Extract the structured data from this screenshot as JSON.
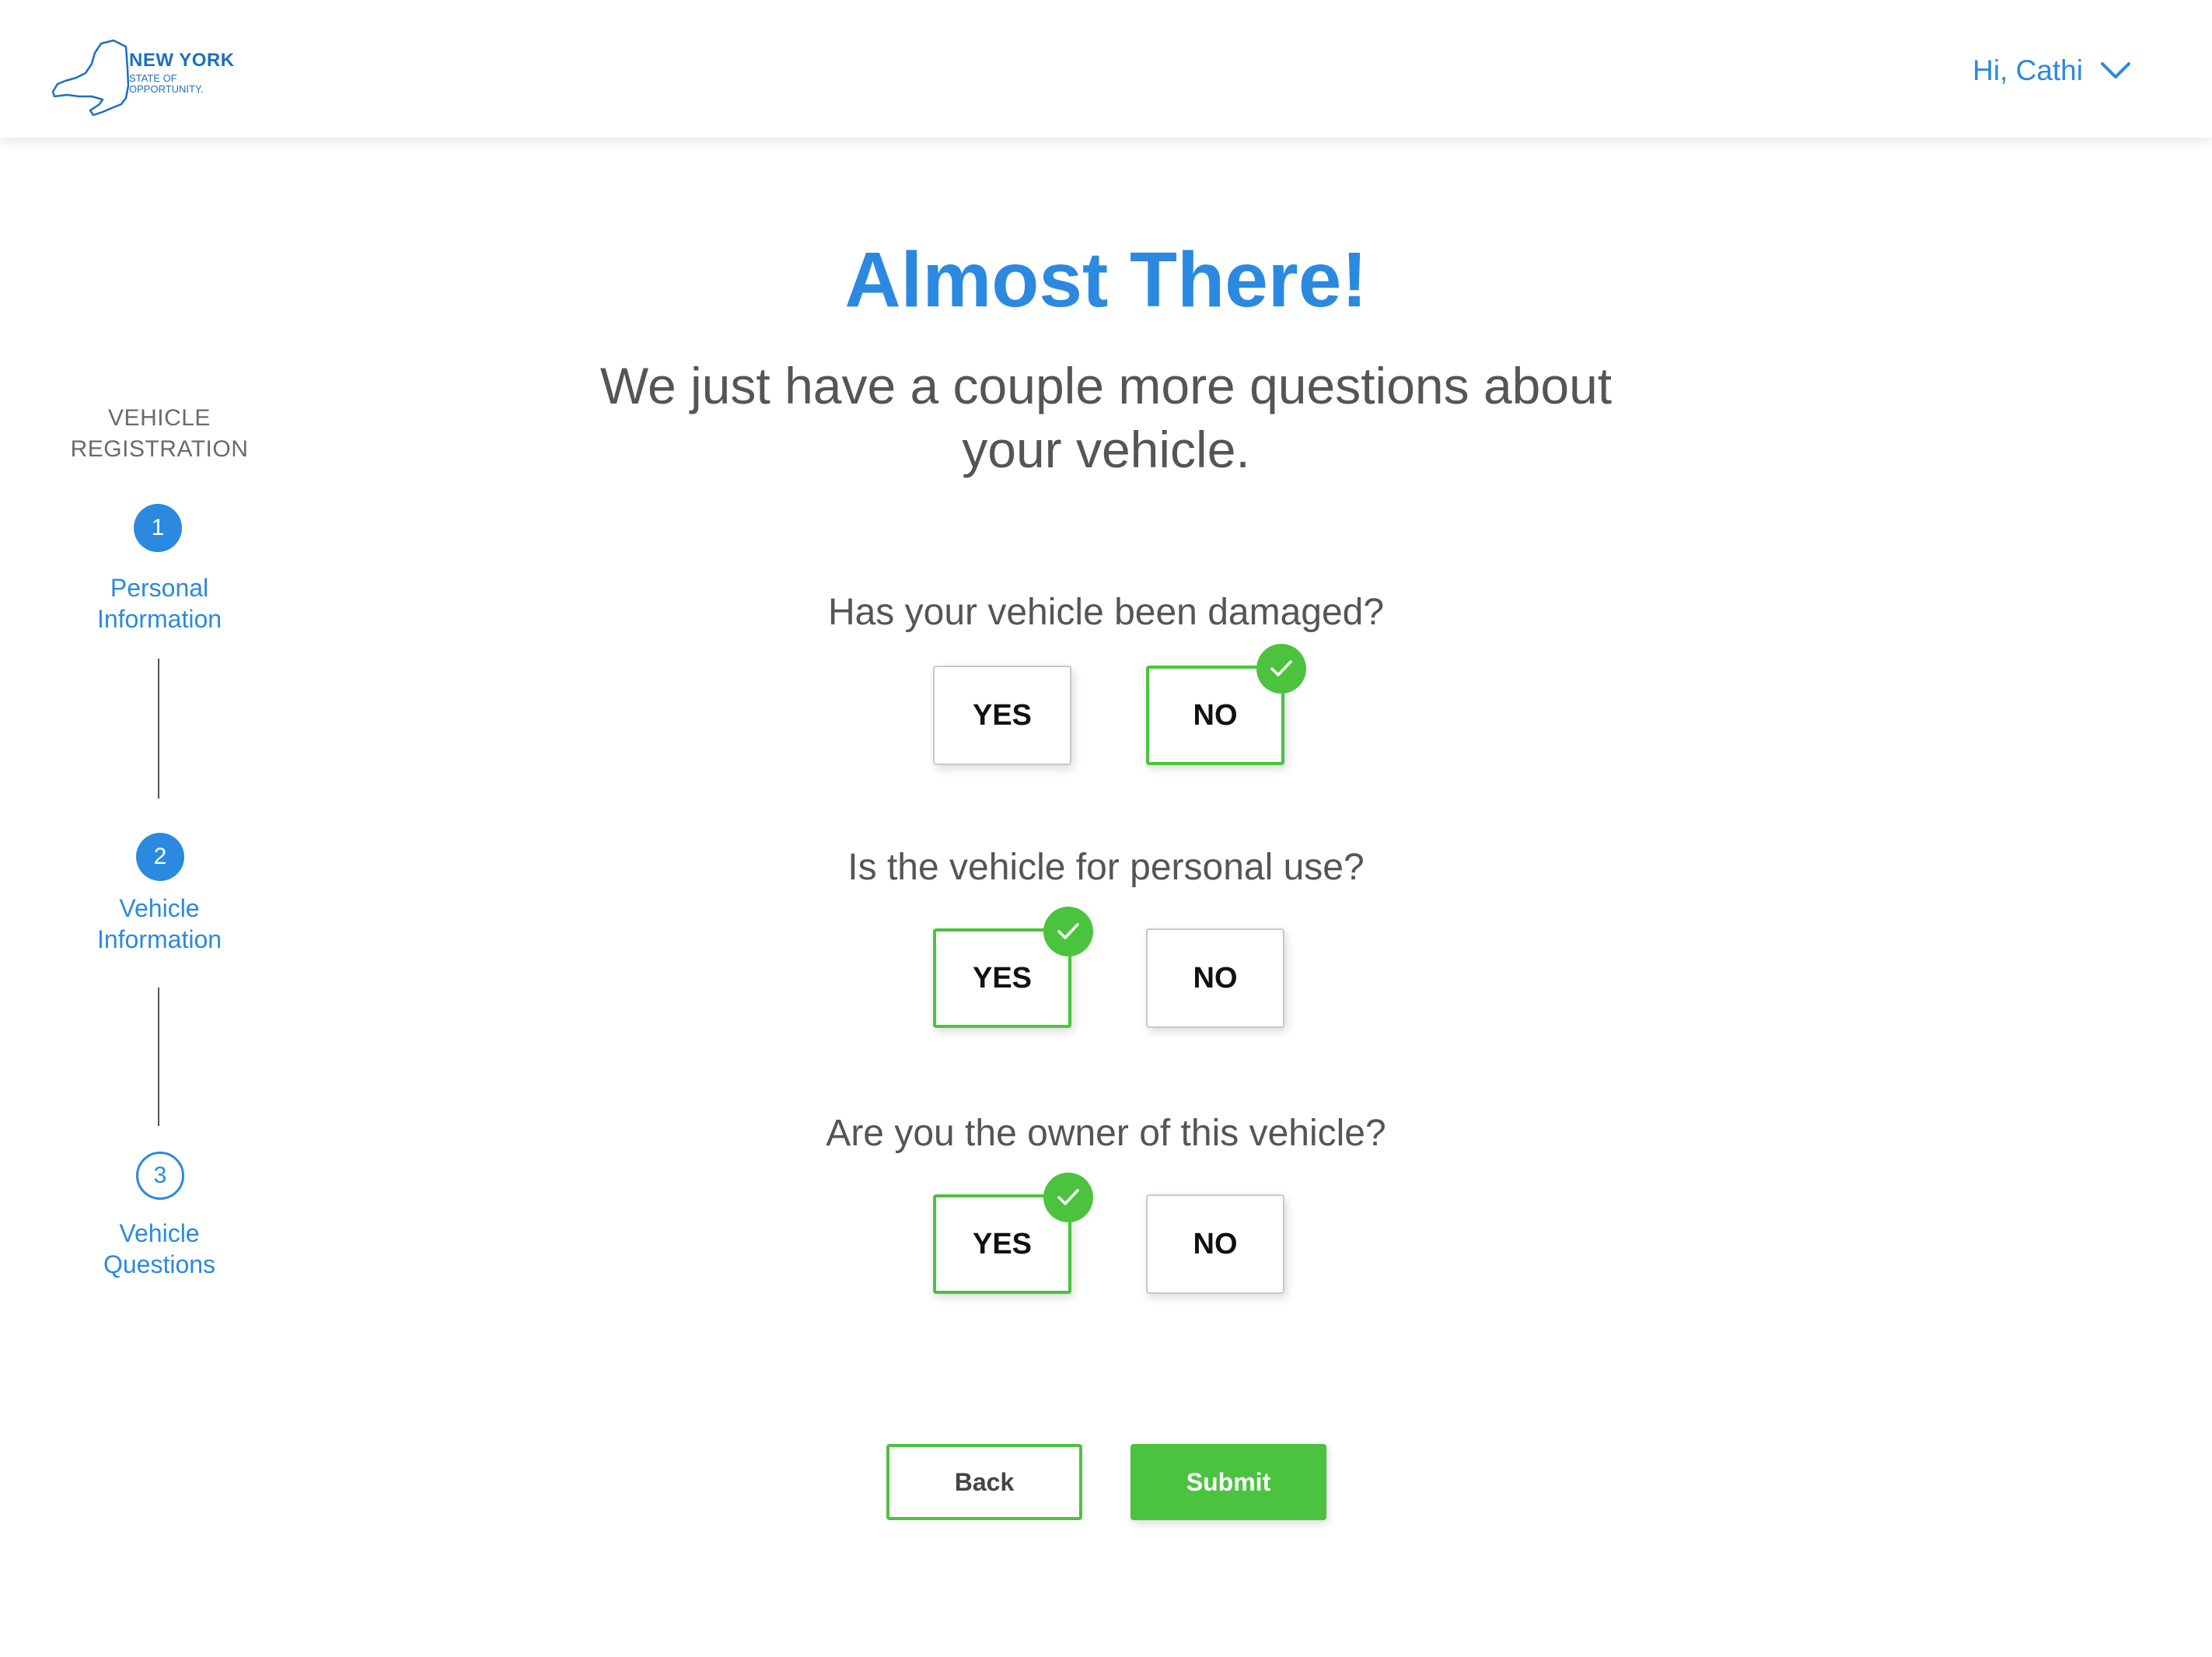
{
  "header": {
    "logo_line1": "NEW YORK",
    "logo_line2": "STATE OF",
    "logo_line3": "OPPORTUNITY.",
    "greeting": "Hi, Cathi"
  },
  "sidebar": {
    "title_line1": "VEHICLE",
    "title_line2": "REGISTRATION",
    "steps": [
      {
        "number": "1",
        "label_line1": "Personal",
        "label_line2": "Information",
        "state": "complete"
      },
      {
        "number": "2",
        "label_line1": "Vehicle",
        "label_line2": "Information",
        "state": "complete"
      },
      {
        "number": "3",
        "label_line1": "Vehicle",
        "label_line2": "Questions",
        "state": "current"
      }
    ]
  },
  "main": {
    "title": "Almost There!",
    "subtitle_line1": "We just have a couple more questions about",
    "subtitle_line2": "your vehicle.",
    "questions": [
      {
        "text": "Has your vehicle been damaged?",
        "yes_label": "YES",
        "no_label": "NO",
        "selected": "NO"
      },
      {
        "text": "Is the vehicle for personal use?",
        "yes_label": "YES",
        "no_label": "NO",
        "selected": "YES"
      },
      {
        "text": "Are you the owner of this vehicle?",
        "yes_label": "YES",
        "no_label": "NO",
        "selected": "YES"
      }
    ],
    "back_label": "Back",
    "submit_label": "Submit"
  },
  "colors": {
    "primary_blue": "#2b89e0",
    "success_green": "#4cc33f",
    "text_gray": "#555555"
  }
}
